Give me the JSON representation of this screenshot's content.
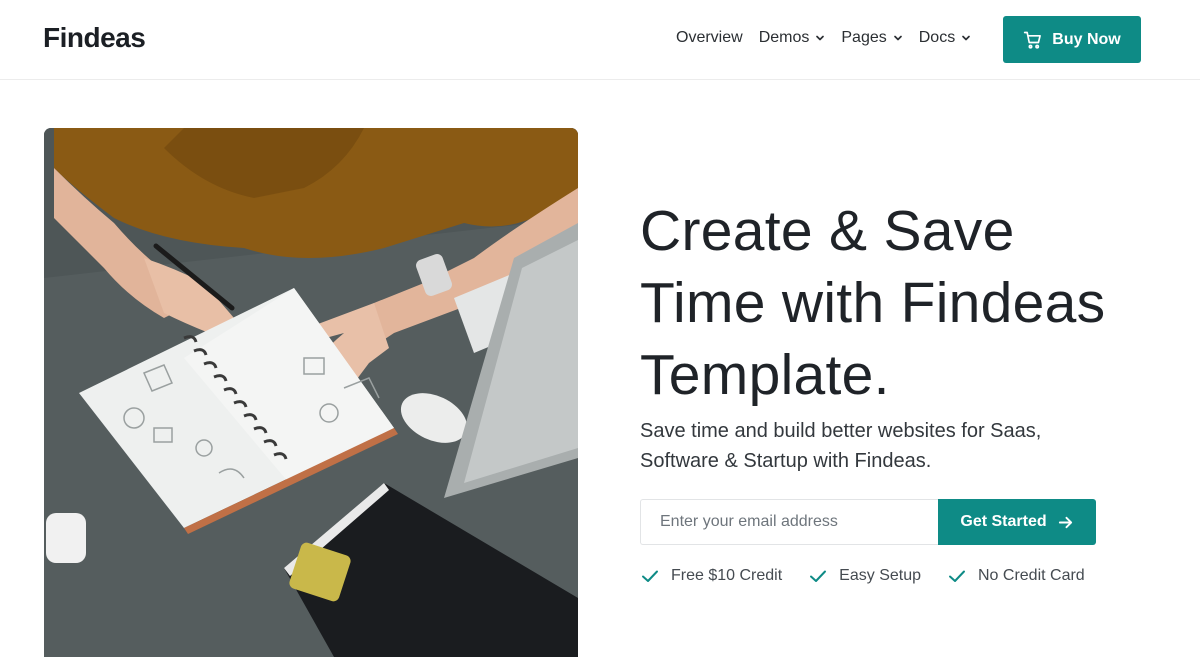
{
  "brand": {
    "logo": "Findeas"
  },
  "nav": {
    "items": [
      {
        "label": "Overview",
        "has_dropdown": false
      },
      {
        "label": "Demos",
        "has_dropdown": true
      },
      {
        "label": "Pages",
        "has_dropdown": true
      },
      {
        "label": "Docs",
        "has_dropdown": true
      }
    ],
    "buy_label": "Buy Now",
    "buy_icon": "cart-icon"
  },
  "hero": {
    "headline_line1": "Create & Save",
    "headline_line2": "Time with Findeas",
    "headline_line3": "Template.",
    "subtext_line1": "Save time and build better websites for Saas,",
    "subtext_line2": "Software & Startup with Findeas.",
    "email_placeholder": "Enter your email address",
    "cta_label": "Get Started",
    "cta_icon": "arrow-right-icon",
    "features": [
      {
        "label": "Free $10 Credit",
        "icon": "check-icon"
      },
      {
        "label": "Easy Setup",
        "icon": "check-icon"
      },
      {
        "label": "No Credit Card",
        "icon": "check-icon"
      }
    ]
  },
  "colors": {
    "accent": "#0e8b86",
    "text": "#1f2328"
  }
}
